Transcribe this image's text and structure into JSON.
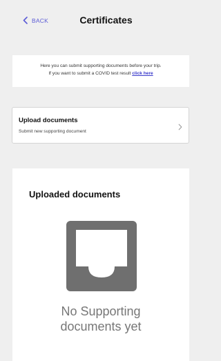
{
  "header": {
    "back_label": "BACK",
    "title": "Certificates"
  },
  "info": {
    "line1": "Here you can submit supporting documents before your trip.",
    "line2_prefix": "If you want to submit a COVID test result ",
    "link_label": "click here"
  },
  "upload": {
    "title": "Upload documents",
    "subtitle": "Submit new supporting document"
  },
  "uploaded": {
    "title": "Uploaded documents",
    "empty_line1": "No Supporting",
    "empty_line2": "documents yet"
  },
  "icons": {
    "back": "chevron-left-icon",
    "row": "chevron-right-icon",
    "empty": "inbox-tray-icon"
  },
  "colors": {
    "accent": "#5b5bd6",
    "link": "#3a3acb",
    "background": "#efefef",
    "icon_gray": "#6f6f6f"
  }
}
